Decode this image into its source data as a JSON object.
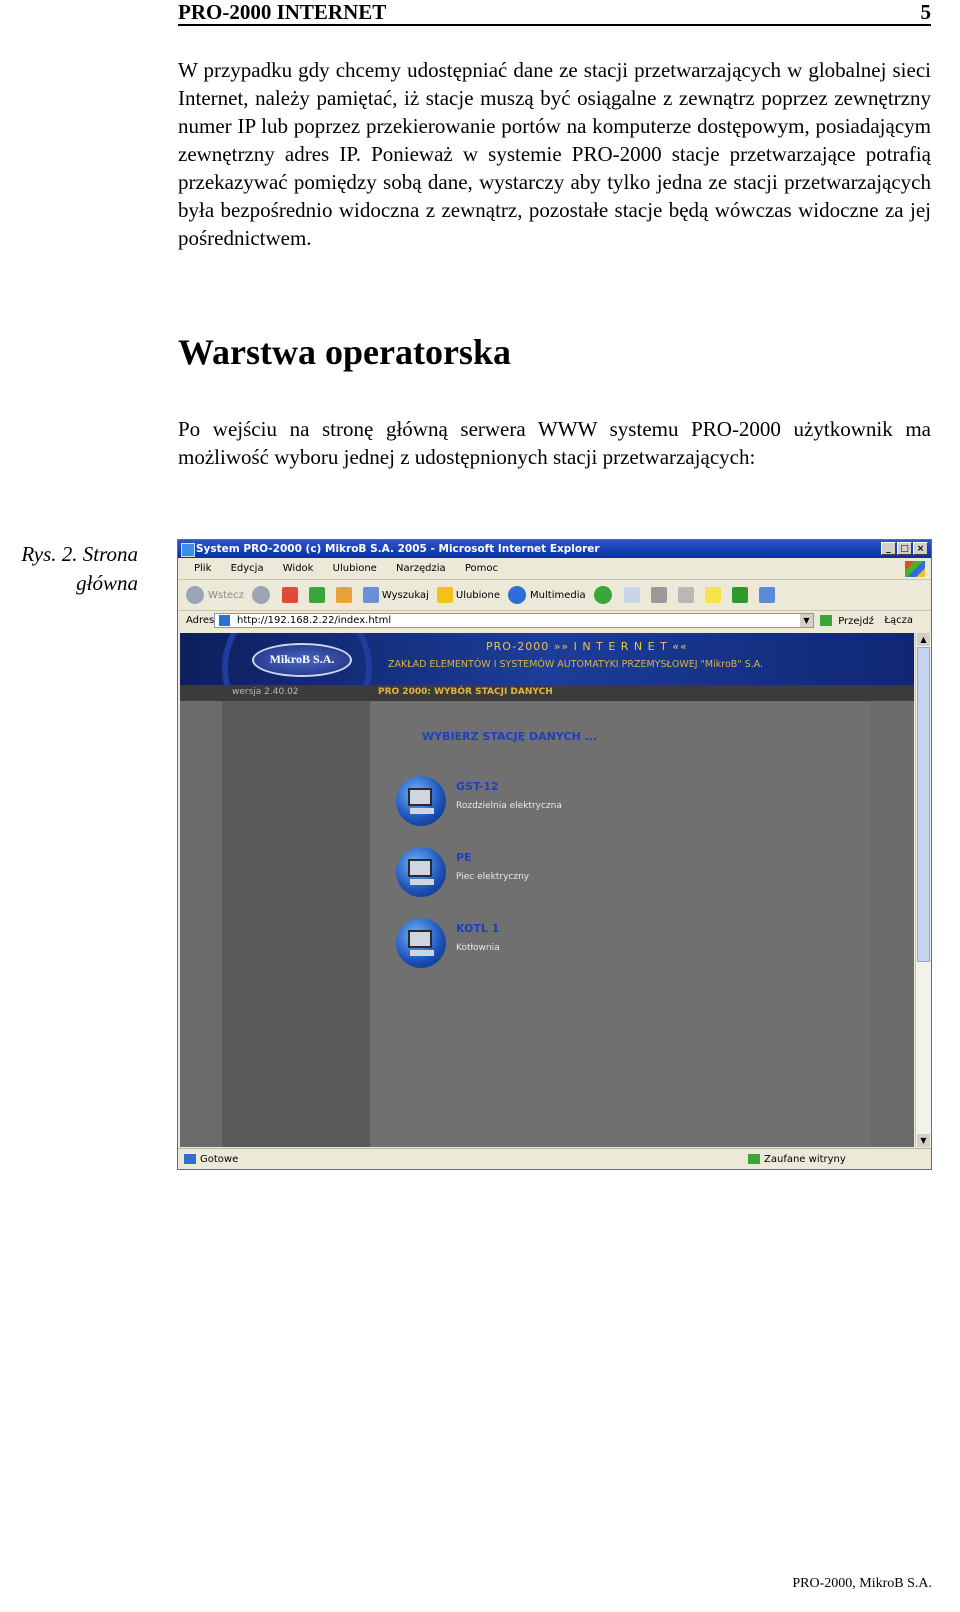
{
  "header": {
    "title": "PRO-2000 INTERNET",
    "page_number": "5"
  },
  "paragraph1": "W przypadku gdy chcemy udostępniać dane ze stacji przetwarzających w globalnej sieci Internet, należy pamiętać, iż stacje muszą być osiągalne z zewnątrz poprzez zewnętrzny numer IP lub poprzez przekierowanie portów na komputerze dostępowym, posiadającym zewnętrzny adres IP. Ponieważ w systemie PRO-2000 stacje przetwarzające potrafią przekazywać pomiędzy sobą dane, wystarczy aby tylko jedna ze stacji przetwarzających była bezpośrednio widoczna z zewnątrz, pozostałe stacje będą wówczas widoczne za jej pośrednictwem.",
  "section_heading": "Warstwa operatorska",
  "paragraph2": "Po wejściu na stronę główną serwera WWW systemu PRO-2000 użytkownik ma możliwość wyboru jednej z udostępnionych stacji przetwarzających:",
  "caption": {
    "line1": "Rys. 2. Strona",
    "line2": "główna"
  },
  "screenshot": {
    "window_title": "System PRO-2000 (c) MikroB S.A. 2005 - Microsoft Internet Explorer",
    "window_buttons": [
      "_",
      "□",
      "×"
    ],
    "menu": [
      "Plik",
      "Edycja",
      "Widok",
      "Ulubione",
      "Narzędzia",
      "Pomoc"
    ],
    "toolbar": {
      "back": "Wstecz",
      "search": "Wyszukaj",
      "favorites": "Ulubione",
      "media": "Multimedia"
    },
    "address_label": "Adres",
    "address_value": "http://192.168.2.22/index.html",
    "go_label": "Przejdź",
    "links_label": "Łącza",
    "banner_logo": "MikroB S.A.",
    "banner_title": "PRO-2000 »» I N T E R N E T ««",
    "banner_subtitle": "ZAKŁAD ELEMENTÓW I SYSTEMÓW AUTOMATYKI PRZEMYSŁOWEJ \"MikroB\" S.A.",
    "version": "wersja 2.40.02",
    "breadcrumb": "PRO 2000: WYBÓR STACJI DANYCH",
    "select_heading": "WYBIERZ STACJĘ DANYCH ...",
    "stations": [
      {
        "name": "GST-12",
        "desc": "Rozdzielnia elektryczna"
      },
      {
        "name": "PE",
        "desc": "Piec elektryczny"
      },
      {
        "name": "KOTL 1",
        "desc": "Kotłownia"
      }
    ],
    "status_left": "Gotowe",
    "status_right": "Zaufane witryny",
    "scroll_up": "▲",
    "scroll_down": "▼"
  },
  "footer": "PRO-2000, MikroB S.A."
}
